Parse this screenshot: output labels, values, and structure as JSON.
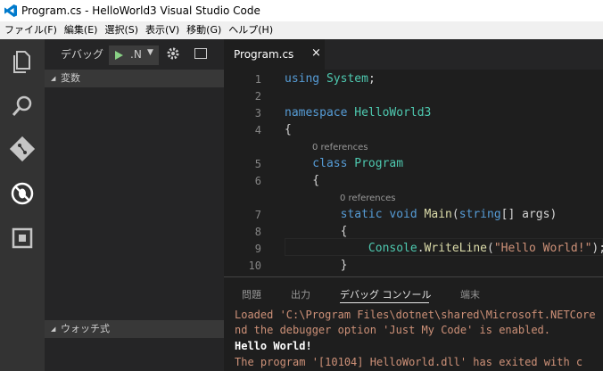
{
  "window": {
    "title": "Program.cs - HelloWorld3  Visual Studio Code"
  },
  "menu": [
    "ファイル(F)",
    "編集(E)",
    "選択(S)",
    "表示(V)",
    "移動(G)",
    "ヘルプ(H)"
  ],
  "debug": {
    "label": "デバッグ",
    "config": ".N"
  },
  "sidebar": {
    "sections": {
      "variables": "変数",
      "watch": "ウォッチ式"
    }
  },
  "editor": {
    "tab": {
      "name": "Program.cs",
      "close": "×"
    },
    "lines": [
      {
        "num": "1",
        "tokens": [
          {
            "t": "using ",
            "c": "kw"
          },
          {
            "t": "System",
            "c": "ty"
          },
          {
            "t": ";",
            "c": "pl"
          }
        ]
      },
      {
        "num": "2",
        "tokens": []
      },
      {
        "num": "3",
        "tokens": [
          {
            "t": "namespace ",
            "c": "kw"
          },
          {
            "t": "HelloWorld3",
            "c": "ty"
          }
        ]
      },
      {
        "num": "4",
        "tokens": [
          {
            "t": "{",
            "c": "pl"
          }
        ]
      },
      {
        "num": "5",
        "lens": "0 references",
        "tokens": [
          {
            "t": "    class ",
            "c": "kw"
          },
          {
            "t": "Program",
            "c": "ty"
          }
        ]
      },
      {
        "num": "6",
        "tokens": [
          {
            "t": "    {",
            "c": "pl"
          }
        ]
      },
      {
        "num": "7",
        "lens": "0 references",
        "tokens": [
          {
            "t": "        static void ",
            "c": "kw"
          },
          {
            "t": "Main",
            "c": "fn"
          },
          {
            "t": "(",
            "c": "pl"
          },
          {
            "t": "string",
            "c": "kw"
          },
          {
            "t": "[] args)",
            "c": "pl"
          }
        ]
      },
      {
        "num": "8",
        "tokens": [
          {
            "t": "        {",
            "c": "pl"
          }
        ]
      },
      {
        "num": "9",
        "tokens": [
          {
            "t": "            ",
            "c": "pl"
          },
          {
            "t": "Console",
            "c": "ty"
          },
          {
            "t": ".",
            "c": "pl"
          },
          {
            "t": "WriteLine",
            "c": "fn"
          },
          {
            "t": "(",
            "c": "pl"
          },
          {
            "t": "\"Hello World!\"",
            "c": "st"
          },
          {
            "t": ");",
            "c": "pl"
          }
        ]
      },
      {
        "num": "10",
        "tokens": [
          {
            "t": "        }",
            "c": "pl"
          }
        ]
      }
    ]
  },
  "panel": {
    "tabs": [
      "問題",
      "出力",
      "デバッグ コンソール",
      "端末"
    ],
    "active_tab": "デバッグ コンソール",
    "console": [
      {
        "text": "Loaded 'C:\\Program Files\\dotnet\\shared\\Microsoft.NETCore",
        "color": "#ce9178"
      },
      {
        "text": "nd the debugger option 'Just My Code' is enabled.",
        "color": "#ce9178"
      },
      {
        "text": "Hello World!",
        "color": "#ffffff"
      },
      {
        "text": "The program '[10104] HelloWorld.dll' has exited with c",
        "color": "#ce9178"
      }
    ]
  },
  "colors": {
    "accent_green": "#89d185",
    "keyword": "#569cd6",
    "type": "#4ec9b0",
    "string": "#ce9178",
    "function": "#dcdcaa"
  }
}
